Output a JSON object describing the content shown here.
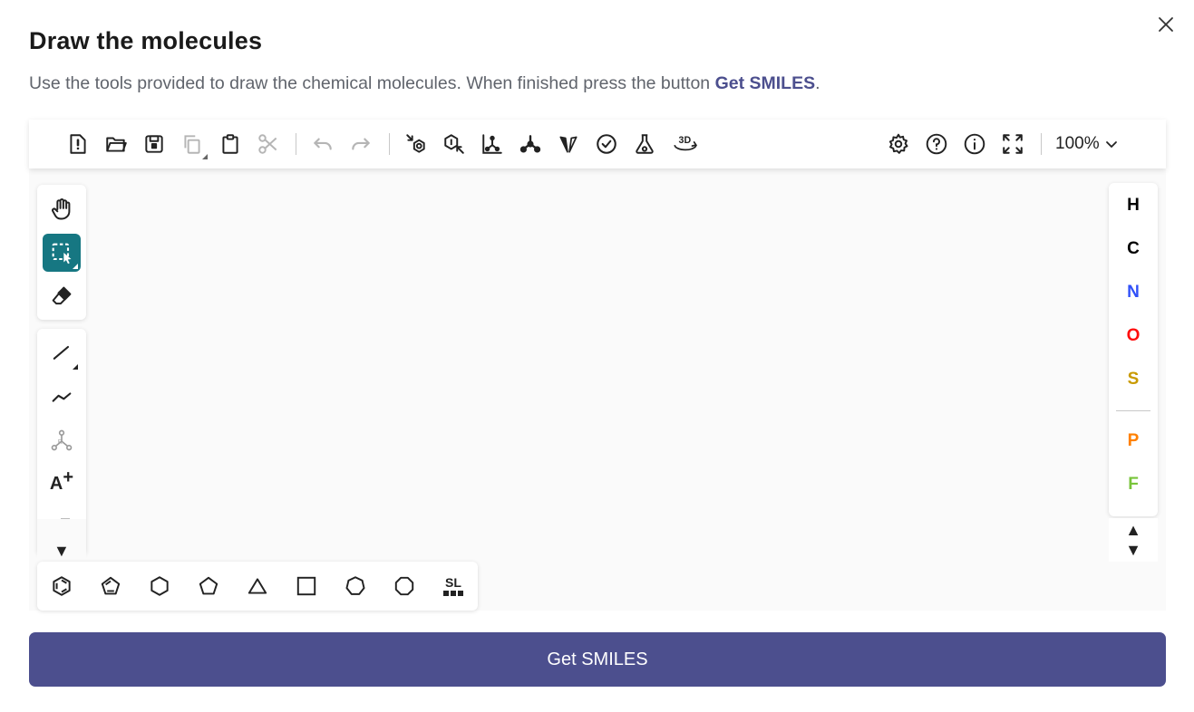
{
  "dialog": {
    "title": "Draw the molecules",
    "subtitle_prefix": "Use the tools provided to draw the chemical molecules. When finished press the button ",
    "subtitle_highlight": "Get SMILES",
    "subtitle_suffix": ".",
    "close_icon": "close-icon"
  },
  "toolbar": {
    "left_icons": [
      "new-file-icon",
      "open-folder-icon",
      "save-icon",
      "copy-icon",
      "paste-icon",
      "cut-icon",
      "undo-icon",
      "redo-icon",
      "aromatize-icon",
      "dearomatize-icon",
      "layout-icon",
      "clean-icon",
      "stereo-icon",
      "check-icon",
      "calculate-icon",
      "3d-view-icon"
    ],
    "right_icons": [
      "settings-icon",
      "help-icon",
      "info-icon",
      "fullscreen-icon"
    ],
    "zoom": "100%"
  },
  "left_tools": {
    "text_tool_label": "A",
    "text_tool_sup": "+",
    "more_arrow": "▼"
  },
  "right_panel": {
    "atoms": [
      {
        "symbol": "H",
        "color": "#000000"
      },
      {
        "symbol": "C",
        "color": "#000000"
      },
      {
        "symbol": "N",
        "color": "#3050F8"
      },
      {
        "symbol": "O",
        "color": "#FF0D0D"
      },
      {
        "symbol": "S",
        "color": "#C99A00"
      },
      {
        "symbol": "P",
        "color": "#FF8000"
      },
      {
        "symbol": "F",
        "color": "#78C43A"
      }
    ],
    "scroll_up": "▲",
    "scroll_down": "▼"
  },
  "bottom_tools": {
    "structure_library_label": "SL"
  },
  "actions": {
    "submit_label": "Get SMILES"
  },
  "colors": {
    "accent": "#4c4f8e",
    "active_tool": "#167782"
  }
}
